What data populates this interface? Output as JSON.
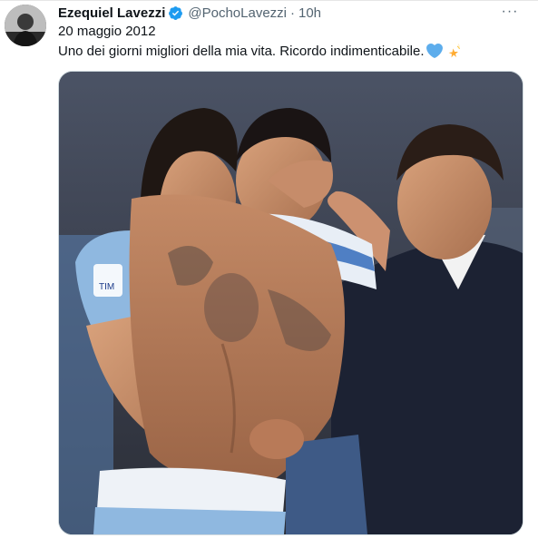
{
  "tweet": {
    "display_name": "Ezequiel Lavezzi",
    "handle": "@PochoLavezzi",
    "separator": "·",
    "time": "10h",
    "more_label": "···",
    "text_line1": "20 maggio 2012",
    "text_line2": "Uno dei giorni migliori della mia vita. Ricordo indimenticabile.",
    "emojis": [
      "blue-heart",
      "dizzy-star"
    ],
    "photo": {
      "shirt_patch_text": "TIM",
      "shirt_color": "#8fb8e0"
    }
  },
  "colors": {
    "verified": "#1d9bf0",
    "secondary_text": "#536471",
    "primary_text": "#0f1419"
  }
}
